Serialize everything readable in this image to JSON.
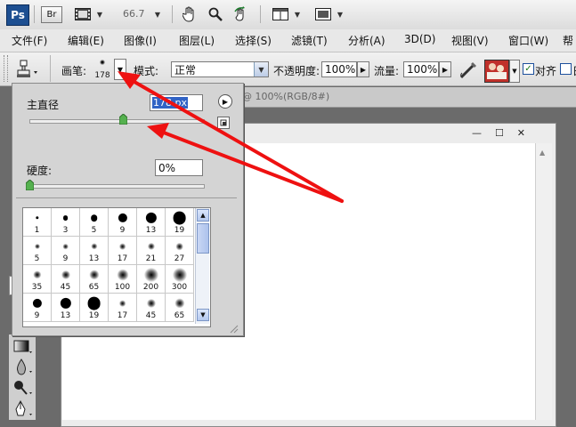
{
  "appbar": {
    "logo": "Ps",
    "bridge": "Br",
    "zoom": "66.7",
    "icons": [
      "film-icon",
      "hand-icon",
      "zoom-icon",
      "rotate-view-icon",
      "arrange-documents-icon",
      "screen-mode-icon"
    ]
  },
  "menu": {
    "items": [
      "文件(F)",
      "编辑(E)",
      "图像(I)",
      "图层(L)",
      "选择(S)",
      "滤镜(T)",
      "分析(A)",
      "3D(D)",
      "视图(V)",
      "窗口(W)",
      "帮"
    ]
  },
  "options": {
    "brush_label": "画笔:",
    "brush_size": "178",
    "mode_label": "模式:",
    "mode_value": "正常",
    "opacity_label": "不透明度:",
    "opacity_value": "100%",
    "flow_label": "流量:",
    "flow_value": "100%",
    "align_label": "对齐",
    "align_checked": true,
    "sample_label": "日"
  },
  "panel": {
    "master_diameter_label": "主直径",
    "master_diameter_value": "178 px",
    "master_diameter_fraction": 0.54,
    "hardness_label": "硬度:",
    "hardness_value": "0%",
    "hardness_fraction": 0.0,
    "presets": [
      {
        "size": "1",
        "hard": true
      },
      {
        "size": "3",
        "hard": true
      },
      {
        "size": "5",
        "hard": true
      },
      {
        "size": "9",
        "hard": true
      },
      {
        "size": "13",
        "hard": true
      },
      {
        "size": "19",
        "hard": true
      },
      {
        "size": "5",
        "hard": false
      },
      {
        "size": "9",
        "hard": false
      },
      {
        "size": "13",
        "hard": false
      },
      {
        "size": "17",
        "hard": false
      },
      {
        "size": "21",
        "hard": false
      },
      {
        "size": "27",
        "hard": false
      },
      {
        "size": "35",
        "hard": false
      },
      {
        "size": "45",
        "hard": false
      },
      {
        "size": "65",
        "hard": false
      },
      {
        "size": "100",
        "hard": false
      },
      {
        "size": "200",
        "hard": false
      },
      {
        "size": "300",
        "hard": false
      },
      {
        "size": "9",
        "hard": true
      },
      {
        "size": "13",
        "hard": true
      },
      {
        "size": "19",
        "hard": true
      },
      {
        "size": "17",
        "hard": false
      },
      {
        "size": "45",
        "hard": false
      },
      {
        "size": "65",
        "hard": false
      }
    ]
  },
  "document": {
    "tab_title": "@ 100%(RGB/8#)"
  },
  "annotation": {
    "color": "#ee1111"
  }
}
